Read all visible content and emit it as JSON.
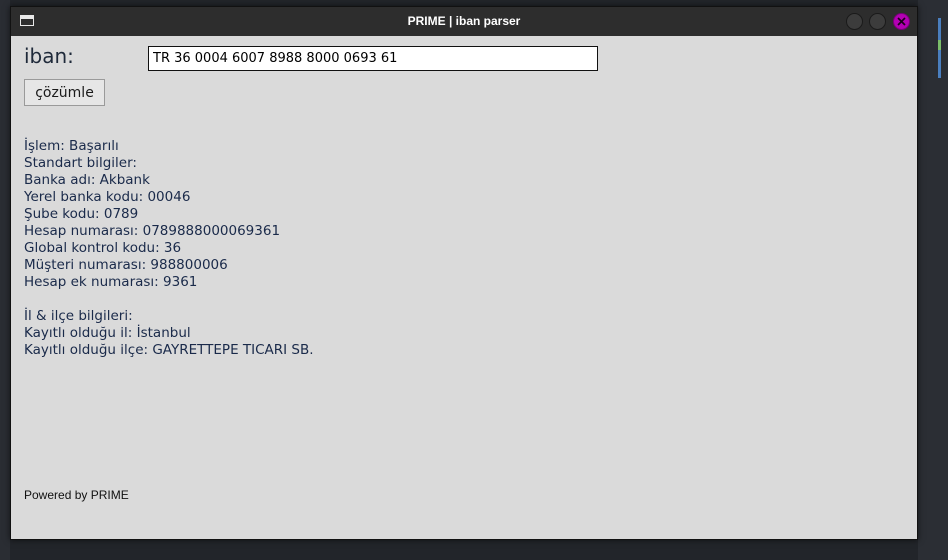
{
  "window": {
    "title": "PRIME | iban parser"
  },
  "form": {
    "iban_label": "iban:",
    "iban_value": "TR 36 0004 6007 8988 8000 0693 61",
    "parse_button": "çözümle"
  },
  "results": {
    "status": "İşlem: Başarılı",
    "standard_header": "Standart bilgiler:",
    "bank_name": "Banka adı: Akbank",
    "local_bank_code": "Yerel banka kodu: 00046",
    "branch_code": "Şube kodu: 0789",
    "account_number": "Hesap numarası: 0789888000069361",
    "global_check_code": "Global kontrol kodu: 36",
    "customer_number": "Müşteri numarası: 988800006",
    "account_suffix": "Hesap ek numarası: 9361",
    "location_header": "İl & ilçe bilgileri:",
    "province": "Kayıtlı olduğu il: İstanbul",
    "district": "Kayıtlı olduğu ilçe: GAYRETTEPE TICARI SB."
  },
  "footer": {
    "powered_by": "Powered by PRIME"
  },
  "icons": {
    "app": "window-icon",
    "minimize": "minimize-icon",
    "maximize": "maximize-icon",
    "close": "close-icon"
  },
  "colors": {
    "titlebar": "#2d2d2d",
    "window_bg": "#dadada",
    "close_button": "#b300b3",
    "result_text": "#1a2a4a"
  }
}
